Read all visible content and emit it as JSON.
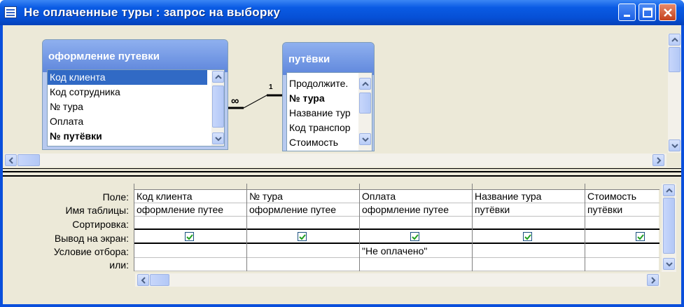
{
  "window": {
    "title": "Не оплаченные туры : запрос на выборку"
  },
  "tables": [
    {
      "title": "оформление путевки",
      "fields": [
        "Код клиента",
        "Код сотрудника",
        "№ тура",
        "Оплата",
        "№ путёвки"
      ],
      "selected_field": "Код клиента"
    },
    {
      "title": "путёвки",
      "fields": [
        "Продолжите.",
        "№ тура",
        "Название тур",
        "Код транспор",
        "Стоимость"
      ]
    }
  ],
  "relationship": {
    "many_label": "∞",
    "one_label": "1"
  },
  "grid": {
    "row_labels": [
      "Поле:",
      "Имя таблицы:",
      "Сортировка:",
      "Вывод на экран:",
      "Условие отбора:",
      "или:"
    ],
    "columns": [
      {
        "field": "Код клиента",
        "table": "оформление путее",
        "sort": "",
        "show": true,
        "criteria": "",
        "or": ""
      },
      {
        "field": "№ тура",
        "table": "оформление путее",
        "sort": "",
        "show": true,
        "criteria": "",
        "or": ""
      },
      {
        "field": "Оплата",
        "table": "оформление путее",
        "sort": "",
        "show": true,
        "criteria": "\"Не оплачено\"",
        "or": ""
      },
      {
        "field": "Название тура",
        "table": "путёвки",
        "sort": "",
        "show": true,
        "criteria": "",
        "or": ""
      },
      {
        "field": "Стоимость",
        "table": "путёвки",
        "sort": "",
        "show": true,
        "criteria": "",
        "or": ""
      }
    ]
  },
  "icons": {
    "title": "query-window-icon",
    "minimize": "minimize-icon",
    "maximize": "maximize-icon",
    "close": "close-icon"
  }
}
